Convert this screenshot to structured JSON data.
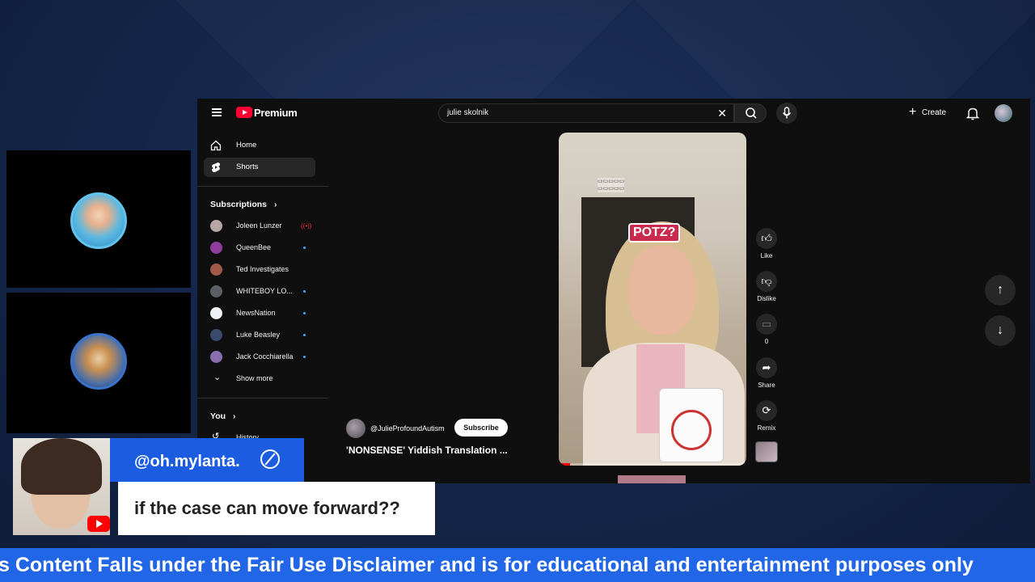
{
  "youtube": {
    "brand": "Premium",
    "search": {
      "query": "julie skolnik"
    },
    "create_label": "Create",
    "sidebar": {
      "nav": [
        {
          "label": "Home"
        },
        {
          "label": "Shorts"
        }
      ],
      "subscriptions_title": "Subscriptions",
      "subscriptions": [
        {
          "label": "Joleen Lunzer",
          "status": "live"
        },
        {
          "label": "QueenBee",
          "status": "dot"
        },
        {
          "label": "Ted Investigates",
          "status": "none"
        },
        {
          "label": "WHITEBOY LO...",
          "status": "dot"
        },
        {
          "label": "NewsNation",
          "status": "dot"
        },
        {
          "label": "Luke Beasley",
          "status": "dot"
        },
        {
          "label": "Jack Cocchiarella",
          "status": "dot"
        }
      ],
      "show_more": "Show more",
      "you_title": "You",
      "history": "History"
    },
    "short": {
      "caption": "POTZ?",
      "channel": "@JulieProfoundAutism",
      "subscribe": "Subscribe",
      "title": "'NONSENSE' Yiddish Translation ...",
      "progress_percent": 6
    },
    "actions": {
      "like": "Like",
      "dislike": "Dislike",
      "comments": "0",
      "share": "Share",
      "remix": "Remix"
    }
  },
  "overlay": {
    "username": "@oh.mylanta.",
    "message": "if the case can move forward??",
    "ticker": "s Content Falls under the Fair Use Disclaimer and is for educational and entertainment purposes only"
  },
  "colors": {
    "background": "#15274b",
    "youtube_red": "#ff0033",
    "overlay_blue": "#1b5ce0",
    "ticker_blue": "#2166e6"
  }
}
